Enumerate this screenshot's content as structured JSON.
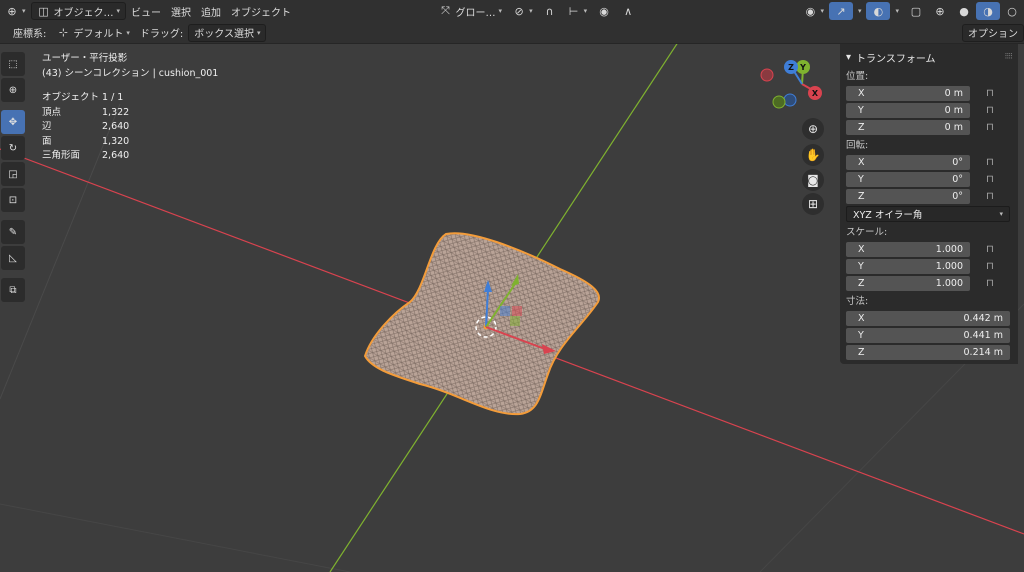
{
  "header": {
    "mode_label": "オブジェク…",
    "menus": [
      "ビュー",
      "選択",
      "追加",
      "オブジェクト"
    ],
    "transform_orientation": "グロー…"
  },
  "subheader": {
    "orientation_label": "座標系:",
    "orientation_value": "デフォルト",
    "drag_label": "ドラッグ:",
    "drag_value": "ボックス選択",
    "options_label": "オプション"
  },
  "viewport": {
    "view_name": "ユーザー・平行投影",
    "collection": "(43) シーンコレクション | cushion_001",
    "stats": [
      {
        "label": "オブジェクト",
        "value": "1 / 1"
      },
      {
        "label": "頂点",
        "value": "1,322"
      },
      {
        "label": "辺",
        "value": "2,640"
      },
      {
        "label": "面",
        "value": "1,320"
      },
      {
        "label": "三角形面",
        "value": "2,640"
      }
    ],
    "gizmo_axes": {
      "x": "X",
      "y": "Y",
      "z": "Z"
    }
  },
  "panel": {
    "title": "トランスフォーム",
    "location_label": "位置:",
    "location": [
      {
        "axis": "X",
        "value": "0 m"
      },
      {
        "axis": "Y",
        "value": "0 m"
      },
      {
        "axis": "Z",
        "value": "0 m"
      }
    ],
    "rotation_label": "回転:",
    "rotation": [
      {
        "axis": "X",
        "value": "0°"
      },
      {
        "axis": "Y",
        "value": "0°"
      },
      {
        "axis": "Z",
        "value": "0°"
      }
    ],
    "rotation_mode": "XYZ オイラー角",
    "scale_label": "スケール:",
    "scale": [
      {
        "axis": "X",
        "value": "1.000"
      },
      {
        "axis": "Y",
        "value": "1.000"
      },
      {
        "axis": "Z",
        "value": "1.000"
      }
    ],
    "dimensions_label": "寸法:",
    "dimensions": [
      {
        "axis": "X",
        "value": "0.442 m"
      },
      {
        "axis": "Y",
        "value": "0.441 m"
      },
      {
        "axis": "Z",
        "value": "0.214 m"
      }
    ]
  },
  "colors": {
    "accent": "#4772b3",
    "x_axis": "#d9434f",
    "y_axis": "#7fb22f",
    "z_axis": "#3f7ed8",
    "selection": "#f39c3a"
  },
  "icons": {
    "toolbar": [
      "select-box-icon",
      "cursor-icon",
      "move-icon",
      "rotate-icon",
      "scale-icon",
      "transform-icon",
      "annotate-icon",
      "measure-icon",
      "add-cube-icon"
    ],
    "nav": [
      "zoom-icon",
      "hand-icon",
      "camera-icon",
      "grid-icon"
    ]
  }
}
